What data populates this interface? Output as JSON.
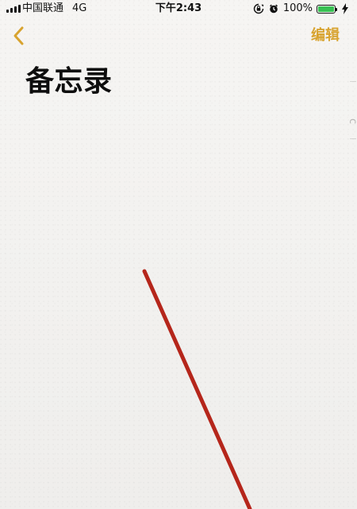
{
  "status_bar": {
    "carrier": "中国联通",
    "network": "4G",
    "time": "下午2:43",
    "battery_text": "100%",
    "battery_level": 1.0
  },
  "nav": {
    "edit_label": "编辑",
    "title": "备忘录"
  },
  "icons": {
    "back": "chevron-left-icon",
    "orientation_lock": "orientation-lock-icon",
    "alarm": "alarm-icon",
    "charging": "charging-bolt-icon"
  },
  "colors": {
    "accent": "#d8a32f",
    "annotation": "#b5261b",
    "battery": "#38c153"
  }
}
